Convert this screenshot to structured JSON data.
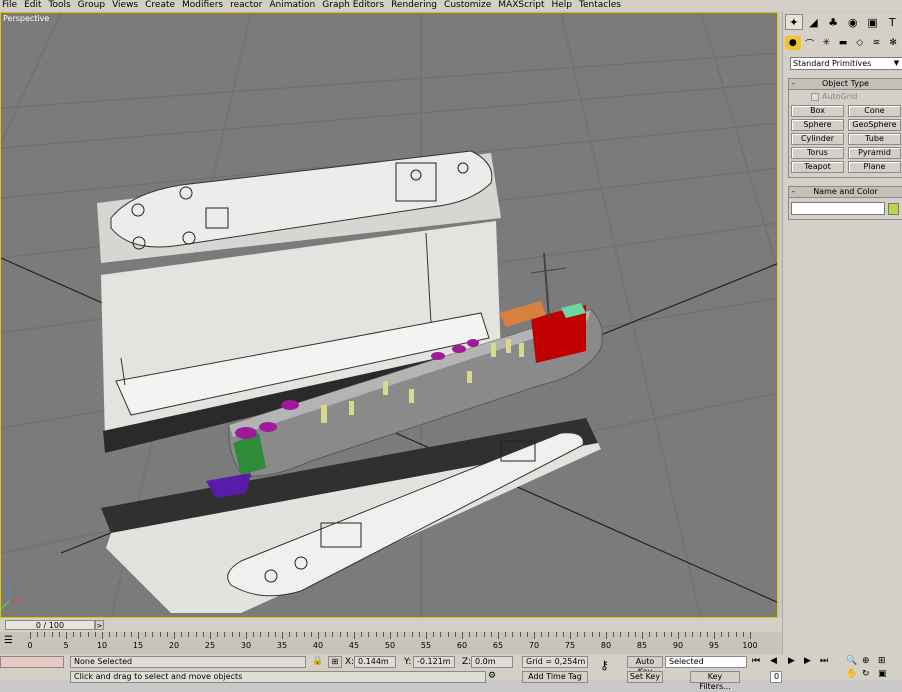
{
  "menu": [
    "File",
    "Edit",
    "Tools",
    "Group",
    "Views",
    "Create",
    "Modifiers",
    "reactor",
    "Animation",
    "Graph Editors",
    "Rendering",
    "Customize",
    "MAXScript",
    "Help",
    "Tentacles"
  ],
  "viewport": {
    "label": "Perspective"
  },
  "command_panel": {
    "category": "Standard Primitives",
    "object_type": {
      "title": "Object Type",
      "autogrid": "AutoGrid",
      "buttons": [
        "Box",
        "Cone",
        "Sphere",
        "GeoSphere",
        "Cylinder",
        "Tube",
        "Torus",
        "Pyramid",
        "Teapot",
        "Plane"
      ]
    },
    "name_color": {
      "title": "Name and Color",
      "swatch_color": "#b8d84a"
    },
    "rollout_sign": "-"
  },
  "timeslider": {
    "label": "0 / 100",
    "arrow": ">"
  },
  "track": {
    "ticks": [
      "0",
      "5",
      "10",
      "15",
      "20",
      "25",
      "30",
      "35",
      "40",
      "45",
      "50",
      "55",
      "60",
      "65",
      "70",
      "75",
      "80",
      "85",
      "90",
      "95",
      "100"
    ]
  },
  "status": {
    "selection": "None Selected",
    "x_label": "X:",
    "x": "0.144m",
    "y_label": "Y:",
    "y": "-0.121m",
    "z_label": "Z:",
    "z": "0.0m",
    "grid": "Grid = 0,254m",
    "prompt": "Click and drag to select and move objects",
    "auto_key": "Auto Key",
    "selected": "Selected",
    "set_key": "Set Key",
    "key_filters": "Key Filters...",
    "add_time_tag": "Add Time Tag",
    "frame": "0"
  }
}
